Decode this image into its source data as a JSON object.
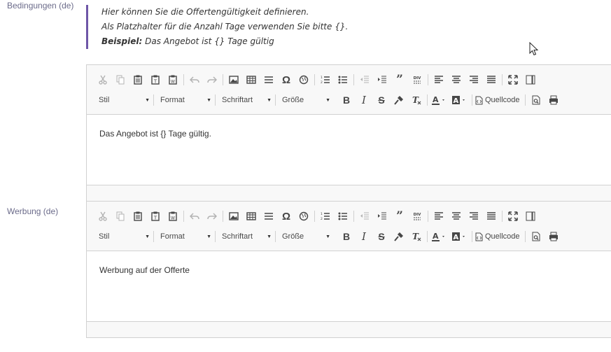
{
  "fields": {
    "conditions": {
      "label": "Bedingungen (de)",
      "hint_line1": "Hier können Sie die Offertengültigkeit definieren.",
      "hint_line2": "Als Platzhalter für die Anzahl Tage verwenden Sie bitte {}.",
      "hint_example_label": "Beispiel:",
      "hint_example_text": " Das Angebot ist {} Tage gültig",
      "content": "Das Angebot ist {} Tage gültig."
    },
    "advertising": {
      "label": "Werbung (de)",
      "content": "Werbung auf der Offerte"
    }
  },
  "toolbar": {
    "style_label": "Stil",
    "format_label": "Format",
    "font_label": "Schriftart",
    "size_label": "Größe",
    "source_label": "Quellcode",
    "icons": [
      "cut-icon",
      "copy-icon",
      "paste-icon",
      "paste-text-icon",
      "paste-word-icon",
      "undo-icon",
      "redo-icon",
      "image-icon",
      "table-icon",
      "horizontal-rule-icon",
      "special-char-icon",
      "link-icon",
      "numbered-list-icon",
      "bulleted-list-icon",
      "outdent-icon",
      "indent-icon",
      "blockquote-icon",
      "div-icon",
      "align-left-icon",
      "align-center-icon",
      "align-right-icon",
      "align-justify-icon",
      "maximize-icon",
      "show-blocks-icon",
      "bold-icon",
      "italic-icon",
      "strikethrough-icon",
      "copy-format-icon",
      "remove-format-icon",
      "text-color-icon",
      "background-color-icon",
      "source-icon",
      "preview-icon",
      "print-icon"
    ]
  },
  "colors": {
    "accent": "#6e56a7",
    "label": "#6b6b8a",
    "border": "#d1d1d1",
    "toolbar_bg": "#f8f8f8"
  }
}
